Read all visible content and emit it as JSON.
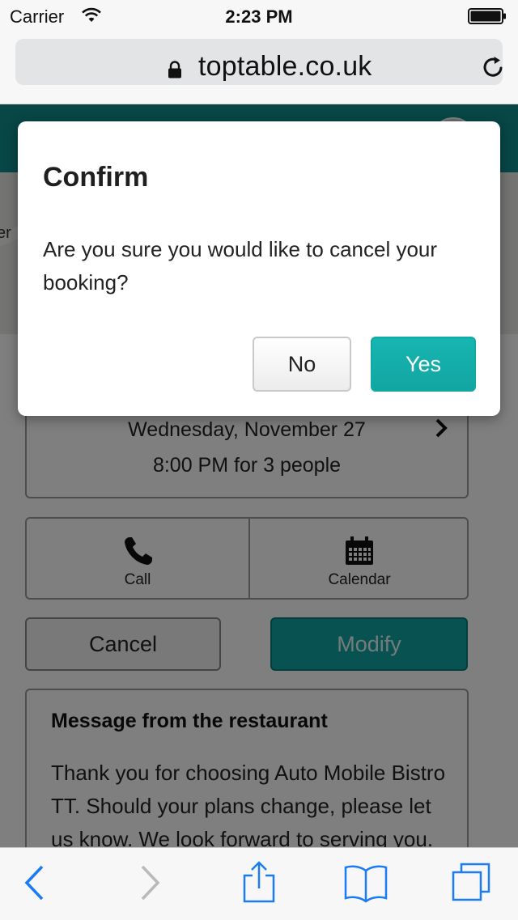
{
  "status_bar": {
    "carrier": "Carrier",
    "time": "2:23 PM"
  },
  "browser": {
    "url": "toptable.co.uk"
  },
  "page": {
    "map_label": "er",
    "booking": {
      "date": "Wednesday, November 27",
      "time_party": "8:00 PM for 3 people"
    },
    "actions": {
      "call_label": "Call",
      "calendar_label": "Calendar"
    },
    "buttons": {
      "cancel_label": "Cancel",
      "modify_label": "Modify"
    },
    "message": {
      "title": "Message from the restaurant",
      "body": "Thank you for choosing Auto Mobile Bistro TT. Should your plans change, please let us know. We look forward to serving you."
    }
  },
  "dialog": {
    "title": "Confirm",
    "message": "Are you sure you would like to cancel your booking?",
    "no_label": "No",
    "yes_label": "Yes"
  },
  "colors": {
    "accent_teal": "#10a6a3",
    "header_teal": "#0e8e8c",
    "ios_blue": "#1a7cf5"
  },
  "icons": {
    "status": [
      "wifi-icon",
      "battery-icon"
    ],
    "url_bar": [
      "lock-icon",
      "reload-icon"
    ],
    "toolbar": [
      "back-icon",
      "forward-icon",
      "share-icon",
      "bookmarks-icon",
      "tabs-icon"
    ]
  }
}
